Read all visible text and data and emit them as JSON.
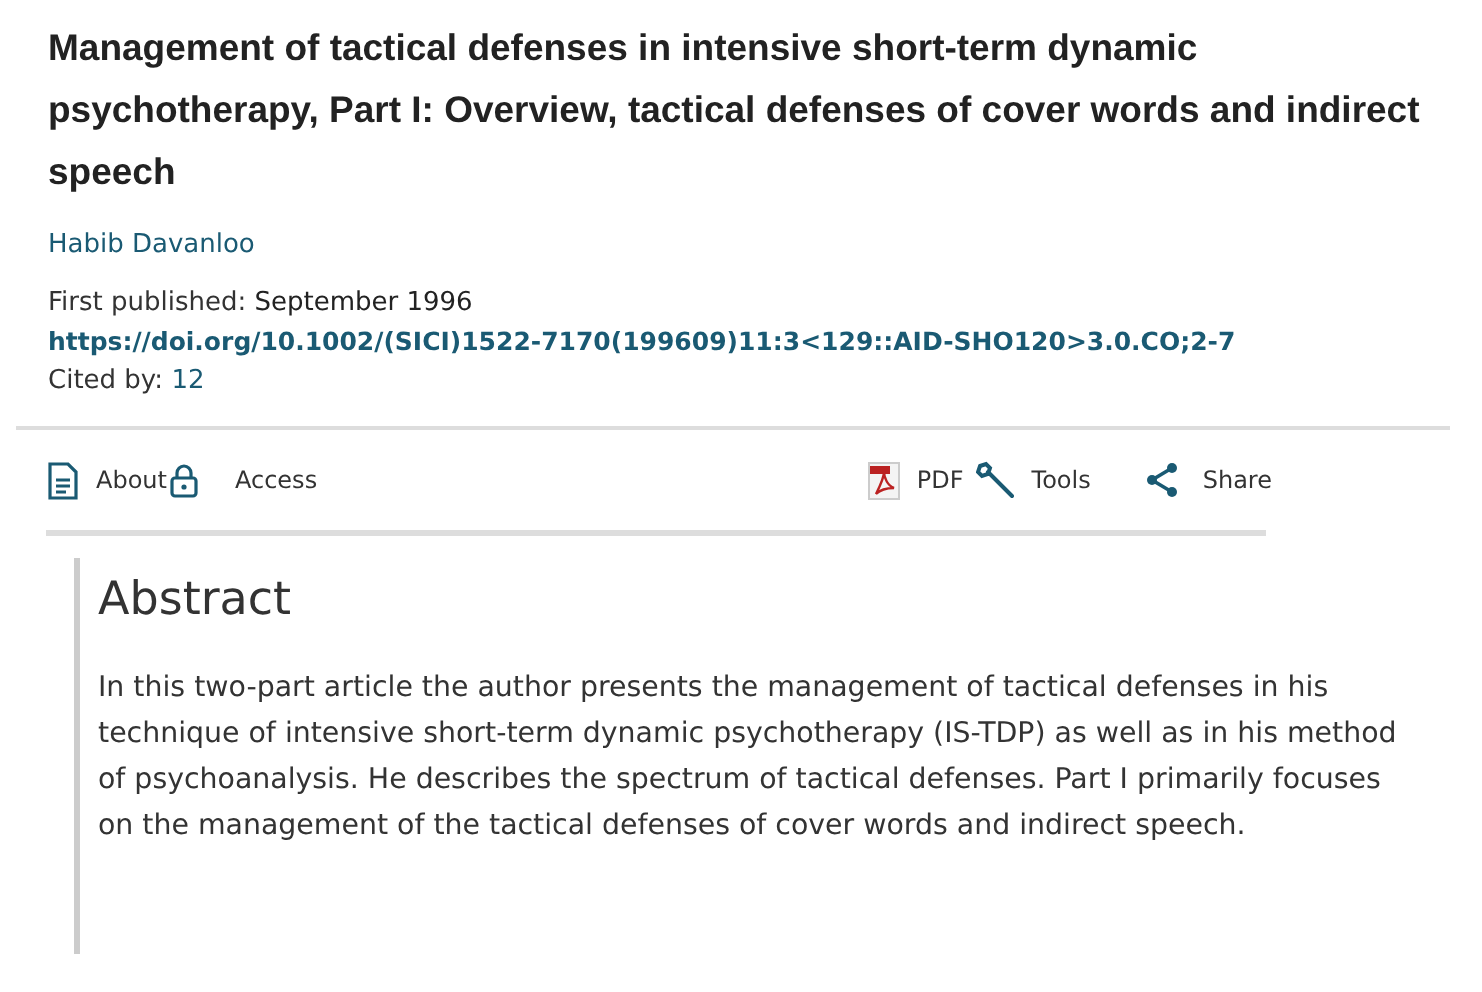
{
  "article": {
    "title": "Management of tactical defenses in intensive short-term dynamic psychotherapy, Part I: Overview, tactical defenses of cover words and indirect speech",
    "author": "Habib Davanloo",
    "published_label": "First published:",
    "published_value": "September 1996",
    "doi": "https://doi.org/10.1002/(SICI)1522-7170(199609)11:3<129::AID-SHO120>3.0.CO;2-7",
    "cited_label": "Cited by:",
    "cited_value": "12"
  },
  "toolbar_left": [
    {
      "kind": "document",
      "label": "About"
    },
    {
      "kind": "lock",
      "label": "Access"
    }
  ],
  "toolbar_right": [
    {
      "kind": "pdf",
      "label": "PDF"
    },
    {
      "kind": "wrench",
      "label": "Tools"
    },
    {
      "kind": "share",
      "label": "Share"
    }
  ],
  "abstract": {
    "heading": "Abstract",
    "text": "In this two-part article the author presents the management of tactical defenses in his technique of intensive short-term dynamic psychotherapy (IS-TDP) as well as in his method of psychoanalysis. He describes the spectrum of tactical defenses. Part I primarily focuses on the management of the tactical defenses of cover words and indirect speech."
  }
}
